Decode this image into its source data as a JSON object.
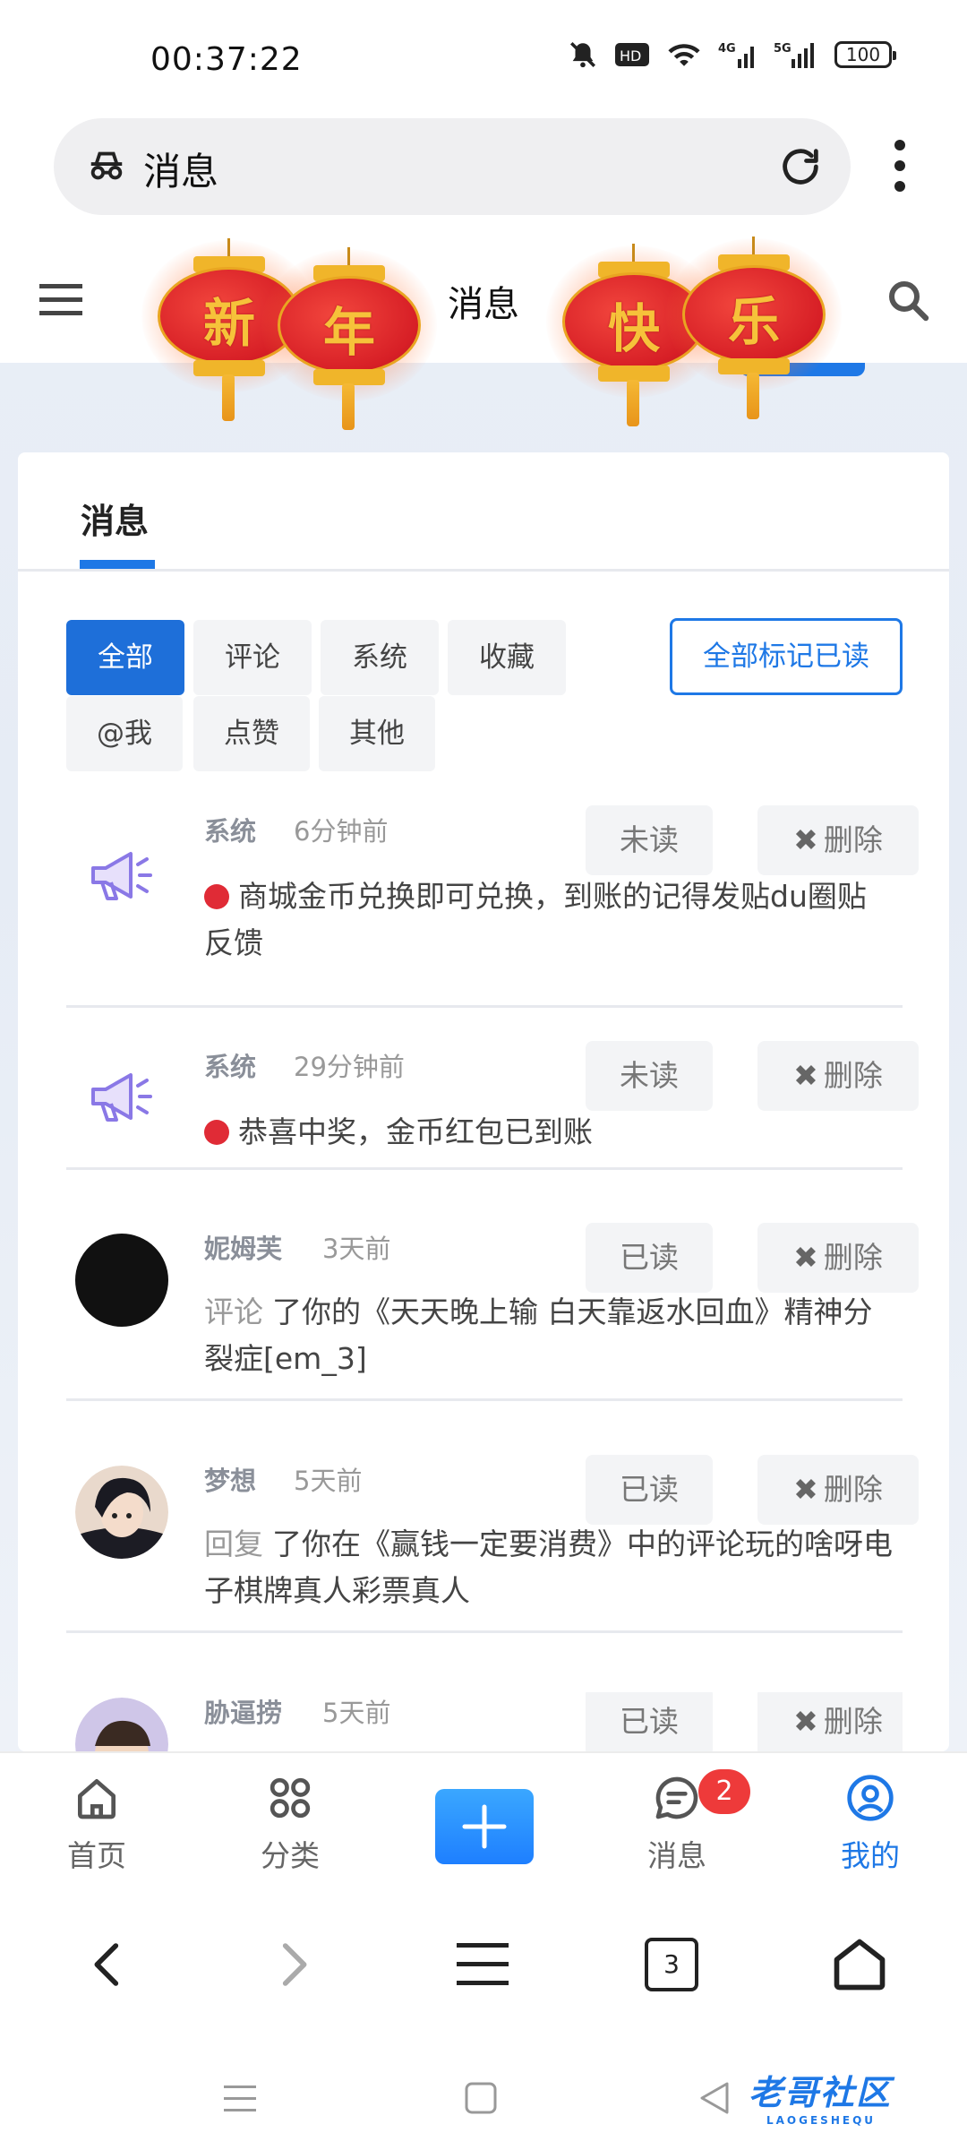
{
  "status_bar": {
    "time": "00:37:22",
    "icons": [
      "mute-bell-icon",
      "hd-icon",
      "wifi-icon",
      "4g-signal-icon",
      "5g-signal-icon"
    ],
    "battery": "100"
  },
  "browser": {
    "url_text": "消息",
    "tab_count": "3"
  },
  "site_header": {
    "title": "消息",
    "lanterns": [
      "新",
      "年",
      "快",
      "乐"
    ]
  },
  "tabs": [
    {
      "label": "消息",
      "active": true
    }
  ],
  "filters": [
    {
      "label": "全部",
      "active": true
    },
    {
      "label": "评论",
      "active": false
    },
    {
      "label": "系统",
      "active": false
    },
    {
      "label": "收藏",
      "active": false
    },
    {
      "label": "@我",
      "active": false
    },
    {
      "label": "点赞",
      "active": false
    },
    {
      "label": "其他",
      "active": false
    }
  ],
  "mark_all_label": "全部标记已读",
  "delete_label": "删除",
  "messages": [
    {
      "sender": "系统",
      "time": "6分钟前",
      "status": "未读",
      "prefix": "",
      "content": "商城金币兑换即可兑换，到账的记得发贴du圈贴反馈",
      "avatar": "megaphone-icon"
    },
    {
      "sender": "系统",
      "time": "29分钟前",
      "status": "未读",
      "prefix": "",
      "content": "恭喜中奖，金币红包已到账",
      "avatar": "megaphone-icon"
    },
    {
      "sender": "妮姆芙",
      "time": "3天前",
      "status": "已读",
      "prefix": "评论",
      "content": "了你的《天天晚上输 白天靠返水回血》精神分裂症[em_3]",
      "avatar": "user-avatar"
    },
    {
      "sender": "梦想",
      "time": "5天前",
      "status": "已读",
      "prefix": "回复",
      "content": "了你在《赢钱一定要消费》中的评论玩的啥呀电子棋牌真人彩票真人",
      "avatar": "user-avatar"
    },
    {
      "sender": "胁逼捞",
      "time": "5天前",
      "status": "已读",
      "prefix": "",
      "content": "",
      "avatar": "user-avatar"
    }
  ],
  "bottom_nav": [
    {
      "label": "首页",
      "icon": "home-icon"
    },
    {
      "label": "分类",
      "icon": "grid-icon"
    },
    {
      "label": "",
      "icon": "plus-icon"
    },
    {
      "label": "消息",
      "icon": "chat-icon",
      "badge": "2"
    },
    {
      "label": "我的",
      "icon": "profile-icon",
      "active": true
    }
  ],
  "watermark": {
    "text": "老哥社区",
    "sub": "LAOGESHEQU"
  },
  "colors": {
    "accent": "#1e78e6",
    "unread_dot": "#e02b36",
    "badge": "#ee3a3a"
  }
}
